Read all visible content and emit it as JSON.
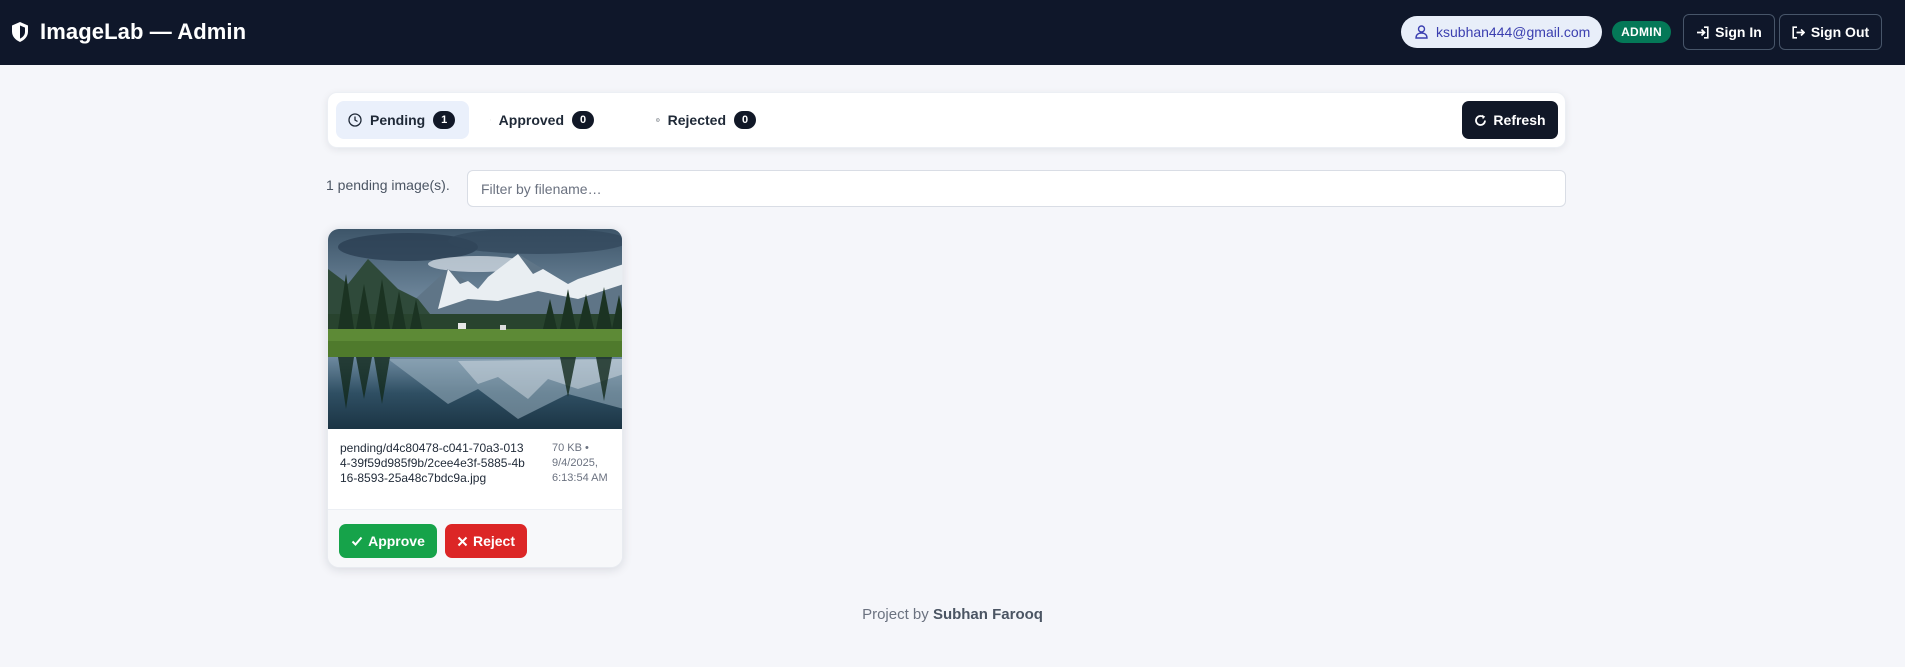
{
  "header": {
    "title": "ImageLab — Admin",
    "user_email": "ksubhan444@gmail.com",
    "role_badge": "ADMIN",
    "sign_in_label": "Sign In",
    "sign_out_label": "Sign Out"
  },
  "tabs": [
    {
      "label": "Pending",
      "count": "1",
      "icon": "clock-icon",
      "active": true
    },
    {
      "label": "Approved",
      "count": "0",
      "icon": "check-circle-icon",
      "active": false
    },
    {
      "label": "Rejected",
      "count": "0",
      "icon": "x-circle-icon",
      "active": false
    }
  ],
  "refresh_label": "Refresh",
  "summary": "1 pending image(s).",
  "filter": {
    "placeholder": "Filter by filename…",
    "value": ""
  },
  "images": [
    {
      "filename": "pending/d4c80478-c041-70a3-0134-39f59d985f9b/2cee4e3f-5885-4b16-8593-25a48c7bdc9a.jpg",
      "info": "70 KB • 9/4/2025, 6:13:54 AM",
      "approve_label": "Approve",
      "reject_label": "Reject"
    }
  ],
  "footer": {
    "prefix": "Project by ",
    "author": "Subhan Farooq"
  },
  "colors": {
    "topbar": "#0f172a",
    "approve": "#16a34a",
    "reject": "#dc2626",
    "admin_badge": "#047857",
    "active_tab": "#eaf0fb"
  }
}
